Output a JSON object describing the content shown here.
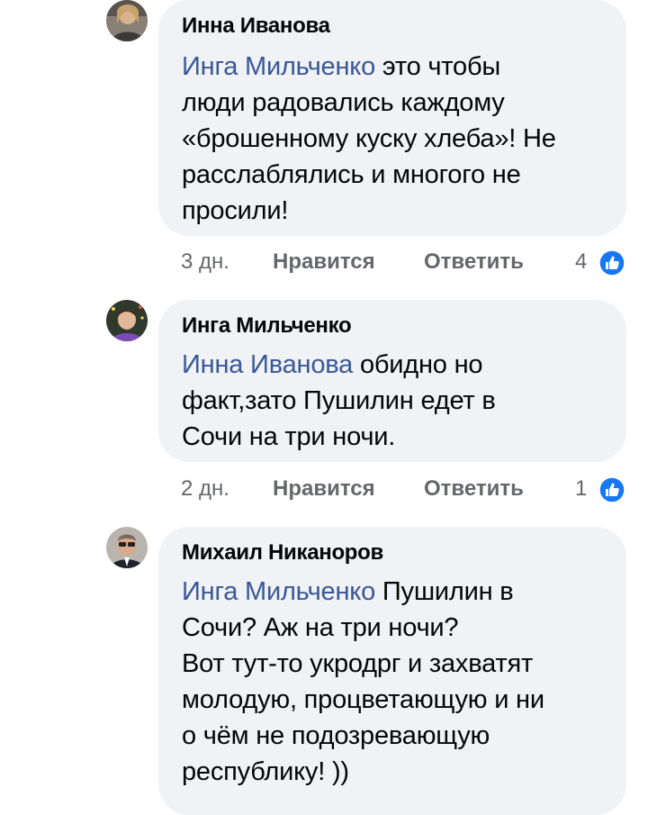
{
  "colors": {
    "bubble": "#f0f2f5",
    "mention": "#385898",
    "meta": "#65676b",
    "like": "#1877f2"
  },
  "comments": [
    {
      "author": "Инна Иванова",
      "mention": "Инга Мильченко",
      "lines": [
        "это чтобы",
        "люди радовались каждому",
        "«брошенному куску хлеба»! Не",
        "расслаблялись и многого не",
        "просили!"
      ],
      "time": "3 дн.",
      "like_label": "Нравится",
      "reply_label": "Ответить",
      "reactions": "4",
      "reaction_icon": "like-thumb-icon"
    },
    {
      "author": "Инга Мильченко",
      "mention": "Инна Иванова",
      "lines": [
        "обидно но",
        "факт,зато Пушилин едет в",
        "Сочи на три ночи."
      ],
      "time": "2 дн.",
      "like_label": "Нравится",
      "reply_label": "Ответить",
      "reactions": "1",
      "reaction_icon": "like-thumb-icon"
    },
    {
      "author": "Михаил Никаноров",
      "mention": "Инга Мильченко",
      "lines": [
        "Пушилин в",
        "Сочи? Аж на три ночи?",
        "Вот тут-то укродрг и захватят",
        "молодую, процветающую и ни",
        "о чём не подозревающую",
        "республику! ))"
      ]
    }
  ]
}
